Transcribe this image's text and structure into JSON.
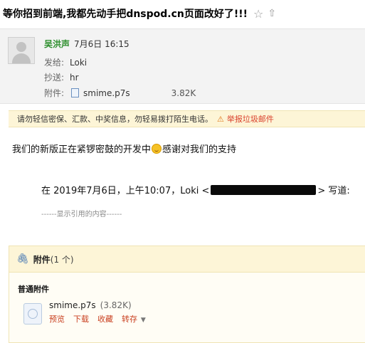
{
  "title": "等你招到前端,我都先动手把dnspod.cn页面改好了!!!",
  "header": {
    "sender_name": "吴洪声",
    "date": "7月6日 16:15",
    "from_label": "发给:",
    "from_value": "Loki",
    "cc_label": "抄送:",
    "cc_value": "hr",
    "attach_label": "附件:",
    "attach_name": "smime.p7s",
    "attach_size": "3.82K"
  },
  "warning": {
    "text": "请勿轻信密保、汇款、中奖信息，勿轻易拨打陌生电话。",
    "report_label": "举报垃圾邮件"
  },
  "message": {
    "body_before": "我们的新版正在紧锣密鼓的开发中",
    "body_after": "感谢对我们的支持"
  },
  "quote": {
    "prefix": "在 2019年7月6日，上午10:07，Loki <",
    "suffix": "> 写道:",
    "show_quoted": "------显示引用的内容------"
  },
  "attachments": {
    "title": "附件",
    "count": "(1 个)",
    "section_label": "普通附件",
    "file_name": "smime.p7s",
    "file_size": "(3.82K)",
    "actions": [
      "预览",
      "下载",
      "收藏"
    ],
    "more_action": "转存"
  }
}
